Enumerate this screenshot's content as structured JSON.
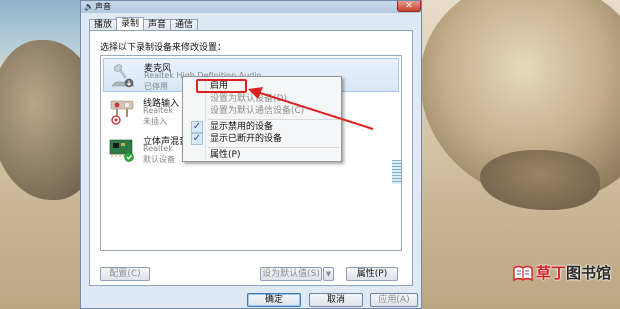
{
  "window": {
    "title": "声音",
    "close_symbol": "✕"
  },
  "tabs": [
    {
      "label": "播放",
      "active": false
    },
    {
      "label": "录制",
      "active": true
    },
    {
      "label": "声音",
      "active": false
    },
    {
      "label": "通信",
      "active": false
    }
  ],
  "panel": {
    "instruction": "选择以下录制设备来修改设置："
  },
  "devices": [
    {
      "name": "麦克风",
      "description": "Realtek High Definition Audio",
      "state": "已停用",
      "icon": "microphone-icon",
      "selected": true
    },
    {
      "name": "线路输入",
      "description": "Realtek",
      "state": "未插入",
      "icon": "line-in-jack-icon",
      "selected": false
    },
    {
      "name": "立体声混音",
      "description": "Realtek",
      "state": "默认设备",
      "icon": "sound-card-icon",
      "selected": false
    }
  ],
  "context_menu": {
    "items": [
      {
        "label": "启用",
        "enabled": true,
        "checked": false,
        "highlighted": true
      },
      {
        "label": "设置为默认设备(D)",
        "enabled": false,
        "checked": false
      },
      {
        "label": "设置为默认通信设备(C)",
        "enabled": false,
        "checked": false
      },
      {
        "label": "显示禁用的设备",
        "enabled": true,
        "checked": true
      },
      {
        "label": "显示已断开的设备",
        "enabled": true,
        "checked": true
      },
      {
        "label": "属性(P)",
        "enabled": true,
        "checked": false
      }
    ]
  },
  "panel_buttons": {
    "configure": "配置(C)",
    "set_default": "设为默认值(S)",
    "dropdown_symbol": "▼",
    "properties": "属性(P)"
  },
  "dialog_buttons": {
    "ok": "确定",
    "cancel": "取消",
    "apply": "应用(A)"
  },
  "annotation": {
    "color": "#e02020"
  },
  "watermark": {
    "part1": "草丁",
    "part2": "图书馆"
  },
  "colors": {
    "accent": "#3d7bbd",
    "selection": "#d7e6f7",
    "check": "#1c56a8"
  }
}
